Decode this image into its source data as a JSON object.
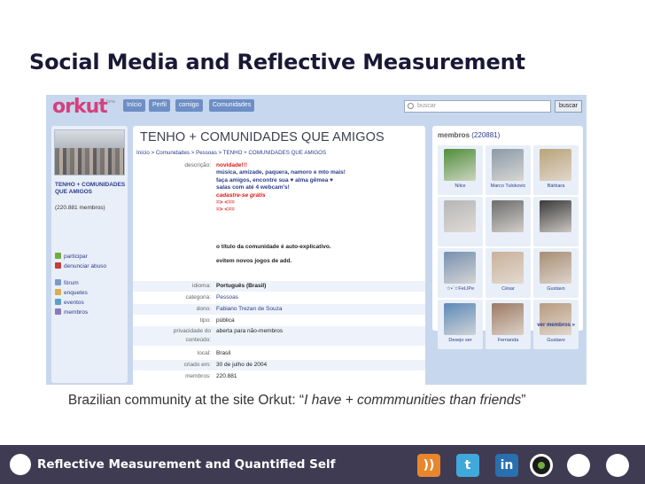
{
  "slide": {
    "title": "Social Media and Reflective Measurement",
    "caption_prefix": "Brazilian community at the site Orkut: “",
    "caption_quote": "I have + commmunities than friends",
    "caption_suffix": "”"
  },
  "orkut": {
    "logo": "orkut",
    "beta": "beta",
    "nav": [
      "Início",
      "Perfil",
      "comigo",
      "Comunidades"
    ],
    "search_placeholder": "buscar",
    "search_button": "buscar",
    "community": {
      "name": "TENHO + COMUNIDADES QUE AMIGOS",
      "members_count": "(220.881 membros)",
      "title": "TENHO + COMUNIDADES QUE AMIGOS",
      "breadcrumb": "Início > Comunidades > Pessoas > TENHO + COMUNIDADES QUE AMIGOS"
    },
    "side_links": [
      {
        "label": "participar",
        "icon": "plus-icon"
      },
      {
        "label": "denunciar abuso",
        "icon": "alert-icon"
      },
      {
        "label": "fórum",
        "icon": "forum-icon"
      },
      {
        "label": "enquetes",
        "icon": "poll-icon"
      },
      {
        "label": "eventos",
        "icon": "calendar-icon"
      },
      {
        "label": "membros",
        "icon": "members-icon"
      }
    ],
    "description_label": "descrição:",
    "description": {
      "line1": "novidade!!!",
      "line2": "música, amizade, paquera, namoro e mto mais!",
      "line3": "faça amigos, encontre sua ♥ alma gêmea ♥",
      "line4": "salas com até 4 webcam's!",
      "line5": "cadastre-se grátis",
      "line6": "=> <==",
      "line7": "=> <==",
      "line8": "o título da comunidade é auto-explicativo.",
      "line9": "evitem novos jogos de add."
    },
    "info": [
      {
        "label": "idioma:",
        "value": "Português (Brasil)"
      },
      {
        "label": "categoria:",
        "value": "Pessoas"
      },
      {
        "label": "dono:",
        "value": "Fabiano Trezan de Souza"
      },
      {
        "label": "tipo:",
        "value": "pública"
      },
      {
        "label": "privacidade do",
        "value": "aberta para não-membros"
      },
      {
        "label": "conteúdo:",
        "value": ""
      },
      {
        "label": "local:",
        "value": "Brasil"
      },
      {
        "label": "criado em:",
        "value": "30 de julho de 2004"
      },
      {
        "label": "membros:",
        "value": "220.881"
      }
    ],
    "members_title": "membros",
    "members_total": "(220881)",
    "members": [
      {
        "name": "Nilce",
        "color": "#4f8e3a"
      },
      {
        "name": "Marco Tulokovic",
        "color": "#8a9aa6"
      },
      {
        "name": "Bárbara",
        "color": "#b9a37a"
      },
      {
        "name": "",
        "color": "#b6b6b6"
      },
      {
        "name": "",
        "color": "#6c6c6c"
      },
      {
        "name": "",
        "color": "#3a3a3a"
      },
      {
        "name": "☆•´☆FeLIPe",
        "color": "#7790b0"
      },
      {
        "name": "César",
        "color": "#c9b19a"
      },
      {
        "name": "Gustavo",
        "color": "#a78d74"
      },
      {
        "name": "Desejo ser",
        "color": "#5b89b8"
      },
      {
        "name": "Fernanda",
        "color": "#9c7a63"
      },
      {
        "name": "Gustavo",
        "color": "#b89b80"
      }
    ],
    "see_more": "ver membros »"
  },
  "footer": {
    "text": "Reflective Measurement and Quantified Self",
    "icons": [
      "rss-icon",
      "twitter-icon",
      "linkedin-icon",
      "quantified-self-icon"
    ]
  }
}
